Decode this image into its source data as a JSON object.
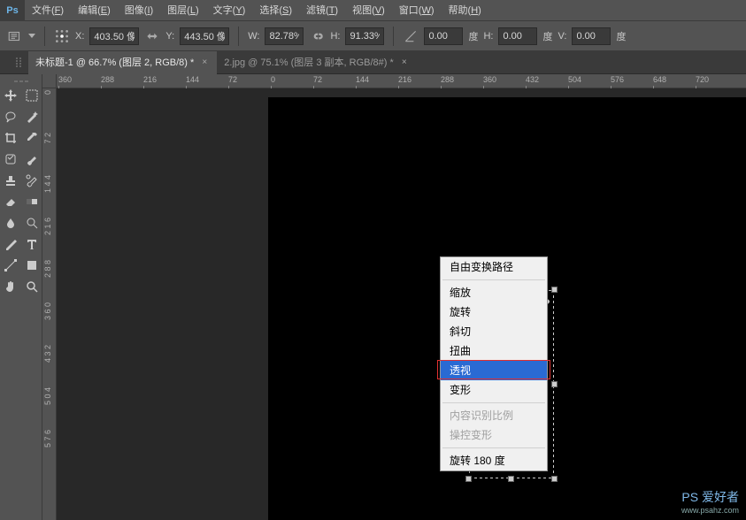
{
  "menubar": {
    "logo": "Ps",
    "items": [
      {
        "label": "文件",
        "mn": "F"
      },
      {
        "label": "编辑",
        "mn": "E"
      },
      {
        "label": "图像",
        "mn": "I"
      },
      {
        "label": "图层",
        "mn": "L"
      },
      {
        "label": "文字",
        "mn": "Y"
      },
      {
        "label": "选择",
        "mn": "S"
      },
      {
        "label": "滤镜",
        "mn": "T"
      },
      {
        "label": "视图",
        "mn": "V"
      },
      {
        "label": "窗口",
        "mn": "W"
      },
      {
        "label": "帮助",
        "mn": "H"
      }
    ]
  },
  "options": {
    "x_label": "X:",
    "x_value": "403.50 像",
    "y_label": "Y:",
    "y_value": "443.50 像",
    "w_label": "W:",
    "w_value": "82.78%",
    "h_label": "H:",
    "h_value": "91.33%",
    "angle_value": "0.00",
    "angle_unit": "度",
    "h2_label": "H:",
    "h2_value": "0.00",
    "h2_unit": "度",
    "v_label": "V:",
    "v_value": "0.00",
    "v_unit": "度"
  },
  "tabs": [
    {
      "label": "未标题-1 @ 66.7% (图层 2, RGB/8) *",
      "active": true
    },
    {
      "label": "2.jpg @ 75.1% (图层 3 副本, RGB/8#) *",
      "active": false
    }
  ],
  "ruler_h": [
    "360",
    "288",
    "216",
    "144",
    "72",
    "0",
    "72",
    "144",
    "216",
    "288",
    "360",
    "432",
    "504",
    "576",
    "648",
    "720"
  ],
  "ruler_v": [
    "0",
    "7 2",
    "1 4 4",
    "2 1 6",
    "2 8 8",
    "3 6 0",
    "4 3 2",
    "5 0 4",
    "5 7 6"
  ],
  "context_menu": {
    "items": [
      {
        "label": "自由变换路径",
        "type": "item"
      },
      {
        "type": "sep"
      },
      {
        "label": "缩放",
        "type": "item"
      },
      {
        "label": "旋转",
        "type": "item"
      },
      {
        "label": "斜切",
        "type": "item"
      },
      {
        "label": "扭曲",
        "type": "item"
      },
      {
        "label": "透视",
        "type": "item",
        "highlight": true
      },
      {
        "label": "变形",
        "type": "item"
      },
      {
        "type": "sep"
      },
      {
        "label": "内容识别比例",
        "type": "item",
        "disabled": true
      },
      {
        "label": "操控变形",
        "type": "item",
        "disabled": true
      },
      {
        "type": "sep"
      },
      {
        "label": "旋转 180 度",
        "type": "item"
      }
    ]
  },
  "tools": [
    "move",
    "marquee",
    "lasso",
    "wand",
    "crop",
    "eyedropper",
    "heal",
    "brush",
    "stamp",
    "history",
    "eraser",
    "gradient",
    "blur",
    "dodge",
    "pen",
    "type",
    "path",
    "shape",
    "hand",
    "zoom"
  ],
  "watermark": {
    "main": "PS 爱好者",
    "sub": "www.psahz.com"
  }
}
